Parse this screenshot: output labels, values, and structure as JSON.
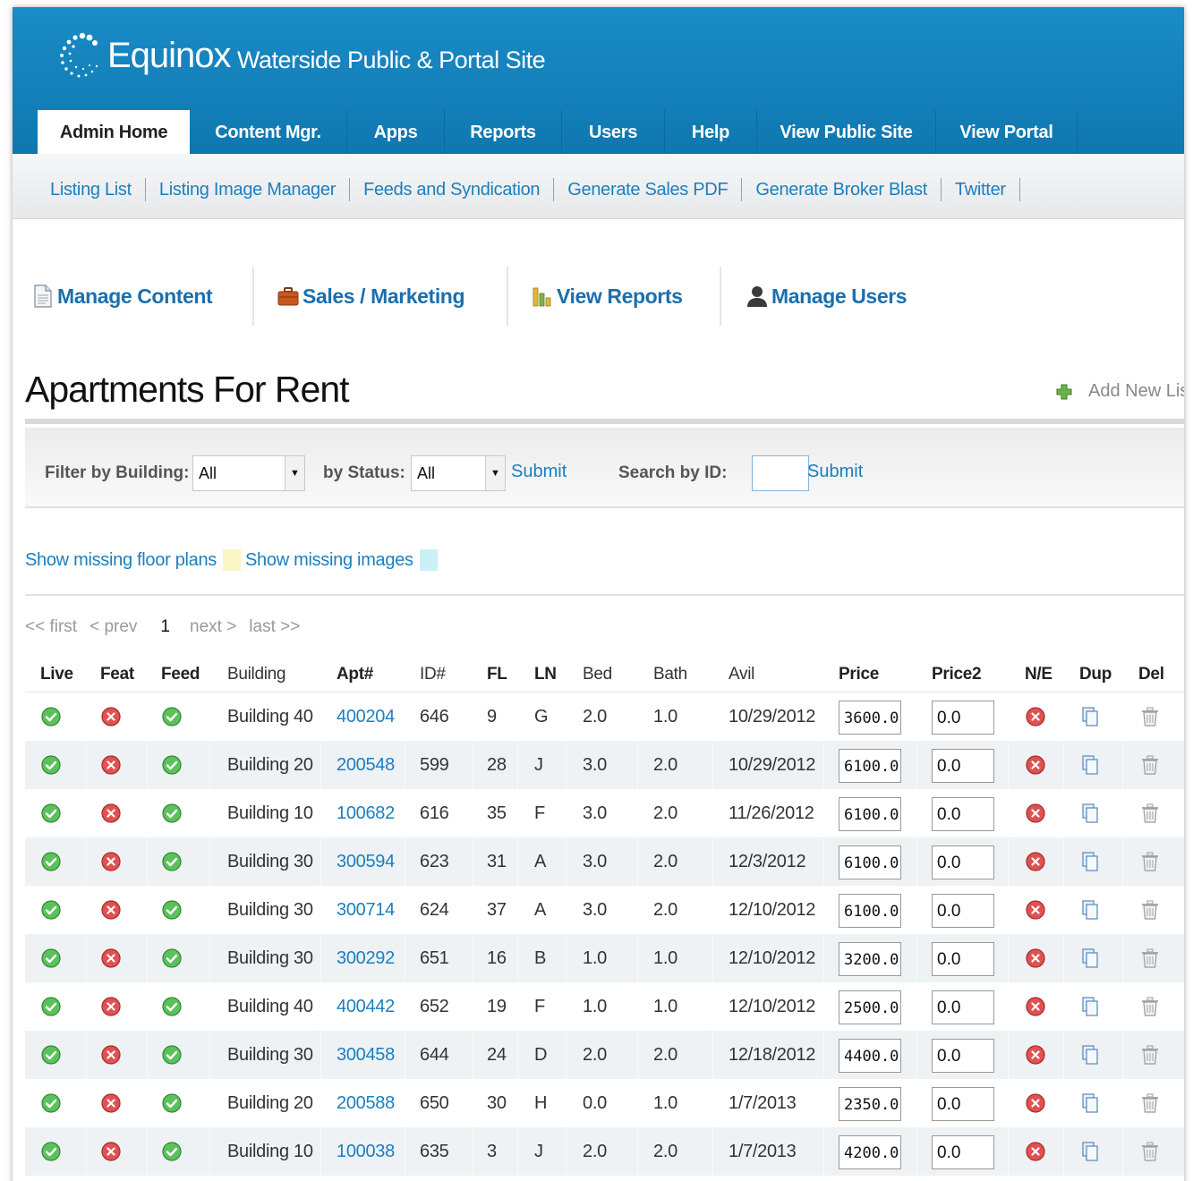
{
  "header": {
    "brand": "Equinox",
    "site_title": "Waterside Public & Portal Site"
  },
  "tabs": [
    {
      "label": "Admin Home",
      "active": true
    },
    {
      "label": "Content Mgr."
    },
    {
      "label": "Apps"
    },
    {
      "label": "Reports"
    },
    {
      "label": "Users"
    },
    {
      "label": "Help"
    },
    {
      "label": "View Public Site"
    },
    {
      "label": "View Portal"
    }
  ],
  "subnav": [
    "Listing List",
    "Listing Image Manager",
    "Feeds and Syndication",
    "Generate Sales PDF",
    "Generate Broker Blast",
    "Twitter"
  ],
  "quick_links": [
    {
      "label": "Manage Content",
      "icon": "document-icon"
    },
    {
      "label": "Sales / Marketing",
      "icon": "briefcase-icon"
    },
    {
      "label": "View Reports",
      "icon": "bar-chart-icon"
    },
    {
      "label": "Manage Users",
      "icon": "user-icon"
    }
  ],
  "page": {
    "title": "Apartments For Rent",
    "add_new": "Add New Listing"
  },
  "filter": {
    "building_label": "Filter by Building:",
    "building_value": "All",
    "status_label": "by Status:",
    "status_value": "All",
    "submit1": "Submit",
    "search_label": "Search by ID:",
    "search_value": "",
    "submit2": "Submit"
  },
  "missing": {
    "floor_plans": "Show missing floor plans",
    "floor_plans_color": "#fbf7c5",
    "images": "Show missing images",
    "images_color": "#c9f1f7"
  },
  "pager": {
    "first": "<< first",
    "prev": "< prev",
    "current": "1",
    "next": "next >",
    "last": "last >>"
  },
  "colors": {
    "live_ok": "#3aa83a",
    "feat_off": "#d83c3c",
    "link": "#1b7fbf",
    "header": "#1583bd"
  },
  "columns": [
    "Live",
    "Feat",
    "Feed",
    "Building",
    "Apt#",
    "ID#",
    "FL",
    "LN",
    "Bed",
    "Bath",
    "Avil",
    "Price",
    "Price2",
    "N/E",
    "Dup",
    "Del"
  ],
  "rows": [
    {
      "building": "Building 40",
      "apt": "400204",
      "id": "646",
      "fl": "9",
      "ln": "G",
      "bed": "2.0",
      "bath": "1.0",
      "avil": "10/29/2012",
      "price": "3600.0",
      "price2": "0.0"
    },
    {
      "building": "Building 20",
      "apt": "200548",
      "id": "599",
      "fl": "28",
      "ln": "J",
      "bed": "3.0",
      "bath": "2.0",
      "avil": "10/29/2012",
      "price": "6100.0",
      "price2": "0.0"
    },
    {
      "building": "Building 10",
      "apt": "100682",
      "id": "616",
      "fl": "35",
      "ln": "F",
      "bed": "3.0",
      "bath": "2.0",
      "avil": "11/26/2012",
      "price": "6100.0",
      "price2": "0.0"
    },
    {
      "building": "Building 30",
      "apt": "300594",
      "id": "623",
      "fl": "31",
      "ln": "A",
      "bed": "3.0",
      "bath": "2.0",
      "avil": "12/3/2012",
      "price": "6100.0",
      "price2": "0.0"
    },
    {
      "building": "Building 30",
      "apt": "300714",
      "id": "624",
      "fl": "37",
      "ln": "A",
      "bed": "3.0",
      "bath": "2.0",
      "avil": "12/10/2012",
      "price": "6100.0",
      "price2": "0.0"
    },
    {
      "building": "Building 30",
      "apt": "300292",
      "id": "651",
      "fl": "16",
      "ln": "B",
      "bed": "1.0",
      "bath": "1.0",
      "avil": "12/10/2012",
      "price": "3200.0",
      "price2": "0.0"
    },
    {
      "building": "Building 40",
      "apt": "400442",
      "id": "652",
      "fl": "19",
      "ln": "F",
      "bed": "1.0",
      "bath": "1.0",
      "avil": "12/10/2012",
      "price": "2500.0",
      "price2": "0.0"
    },
    {
      "building": "Building 30",
      "apt": "300458",
      "id": "644",
      "fl": "24",
      "ln": "D",
      "bed": "2.0",
      "bath": "2.0",
      "avil": "12/18/2012",
      "price": "4400.0",
      "price2": "0.0"
    },
    {
      "building": "Building 20",
      "apt": "200588",
      "id": "650",
      "fl": "30",
      "ln": "H",
      "bed": "0.0",
      "bath": "1.0",
      "avil": "1/7/2013",
      "price": "2350.0",
      "price2": "0.0"
    },
    {
      "building": "Building 10",
      "apt": "100038",
      "id": "635",
      "fl": "3",
      "ln": "J",
      "bed": "2.0",
      "bath": "2.0",
      "avil": "1/7/2013",
      "price": "4200.0",
      "price2": "0.0"
    }
  ]
}
